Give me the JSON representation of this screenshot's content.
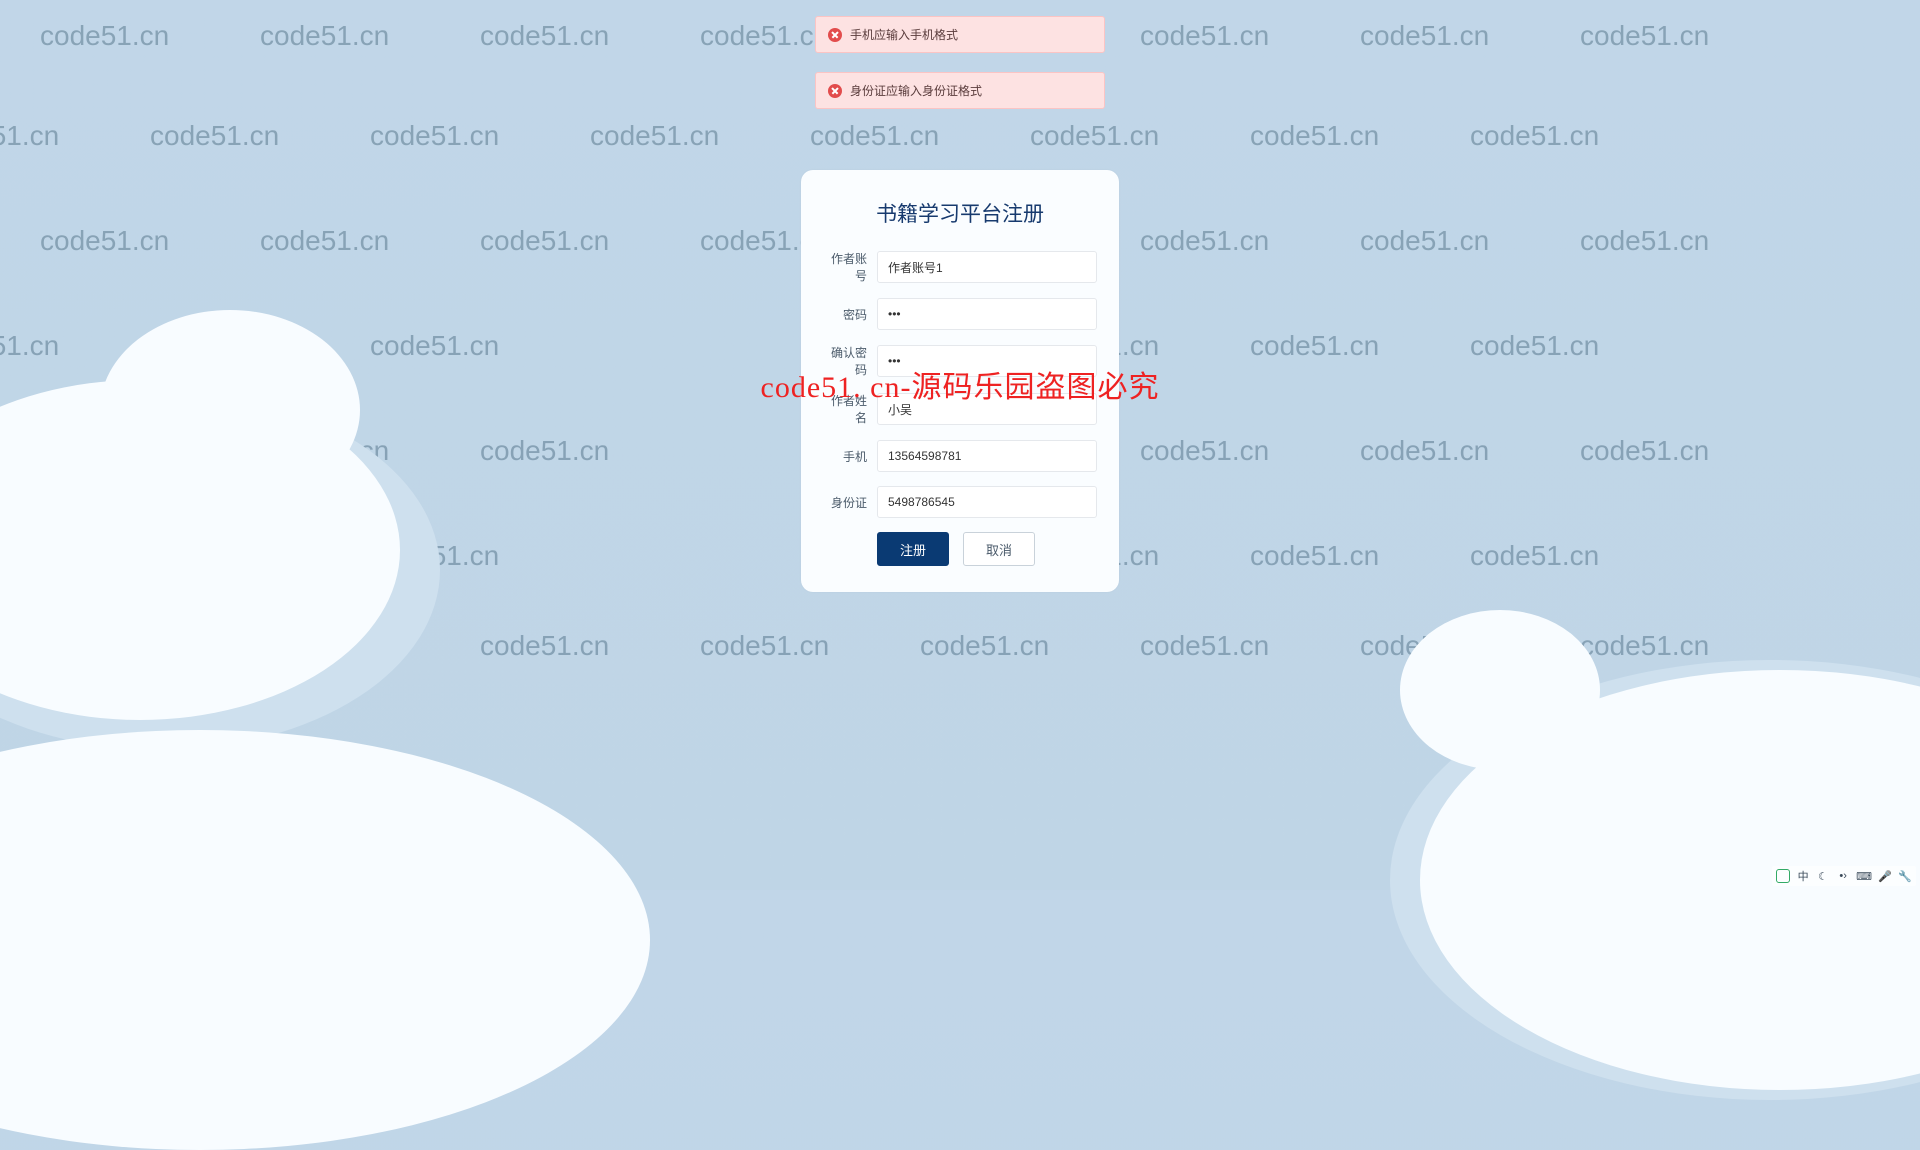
{
  "watermark_text": "code51.cn",
  "errors": [
    {
      "message": "手机应输入手机格式"
    },
    {
      "message": "身份证应输入身份证格式"
    }
  ],
  "register": {
    "title": "书籍学习平台注册",
    "fields": {
      "account": {
        "label": "作者账号",
        "value": "作者账号1"
      },
      "password": {
        "label": "密码",
        "value": "123"
      },
      "confirm": {
        "label": "确认密码",
        "value": "123"
      },
      "name": {
        "label": "作者姓名",
        "value": "小吴"
      },
      "phone": {
        "label": "手机",
        "value": "13564598781"
      },
      "idcard": {
        "label": "身份证",
        "value": "5498786545"
      }
    },
    "buttons": {
      "submit": "注册",
      "cancel": "取消"
    }
  },
  "overlay": "code51. cn-源码乐园盗图必究",
  "ime": {
    "lang": "中"
  }
}
